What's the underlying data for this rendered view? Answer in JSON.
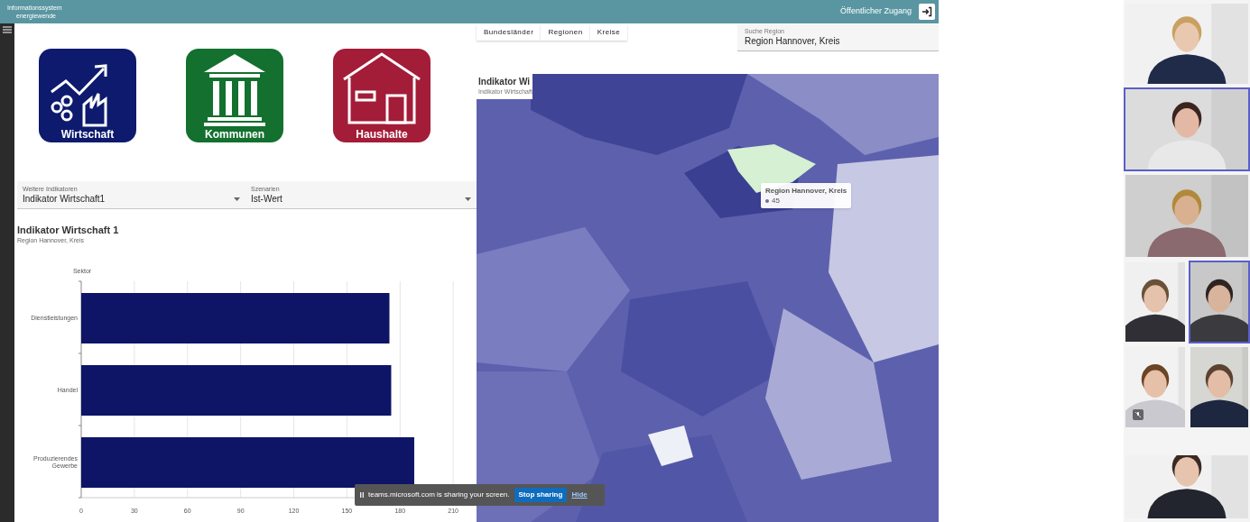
{
  "header": {
    "title_lines": [
      "Informationssystem",
      "energiewende"
    ],
    "access_label": "Öffentlicher Zugang"
  },
  "categories": [
    {
      "kind": "economy",
      "label": "Wirtschaft",
      "color": "#0d1a6e"
    },
    {
      "kind": "municipal",
      "label": "Kommunen",
      "color": "#13702f"
    },
    {
      "kind": "household",
      "label": "Haushalte",
      "color": "#a31c38"
    }
  ],
  "filters": [
    {
      "label": "Weitere Indikatoren",
      "value": "Indikator Wirtschaft1"
    },
    {
      "label": "Szenarien",
      "value": "Ist-Wert"
    }
  ],
  "chart": {
    "title": "Indikator Wirtschaft 1",
    "subtitle": "Region Hannover, Kreis",
    "chart_data": {
      "type": "bar",
      "orientation": "horizontal",
      "ylabel": "Sektor",
      "categories": [
        "Dienstleistungen",
        "Handel",
        "Produzierendes Gewerbe"
      ],
      "series": [
        {
          "color": "#0e1466",
          "values": [
            174,
            175,
            188
          ]
        }
      ],
      "grid": true,
      "xlim": [
        0,
        214
      ],
      "xticks": [
        0,
        30,
        60,
        90,
        120,
        150,
        180,
        210
      ]
    }
  },
  "level_tabs": [
    {
      "label": "Bundesländer",
      "selected": false
    },
    {
      "label": "Regionen",
      "selected": false
    },
    {
      "label": "Kreise",
      "selected": false
    }
  ],
  "search": {
    "label": "Suche Region",
    "value": "Region Hannover, Kreis"
  },
  "map": {
    "kind": "picture",
    "title": "Indikator Wi",
    "subtitle": "Indikator Wirtschaft",
    "tooltip": {
      "title": "Region Hannover, Kreis",
      "value": "45"
    }
  },
  "share_bar": {
    "message": "teams.microsoft.com is sharing your screen.",
    "stop_label": "Stop sharing",
    "hide_label": "Hide"
  },
  "participants": [
    {
      "kind": "picture",
      "highlighted": false,
      "muted": false
    },
    {
      "kind": "picture",
      "highlighted": true,
      "muted": false
    },
    {
      "kind": "picture",
      "highlighted": false,
      "muted": false
    },
    {
      "kind": "picture",
      "highlighted": false,
      "muted": false
    },
    {
      "kind": "picture",
      "highlighted": true,
      "muted": false
    },
    {
      "kind": "picture",
      "highlighted": false,
      "muted": true
    },
    {
      "kind": "picture",
      "highlighted": false,
      "muted": false
    },
    {
      "kind": "picture",
      "highlighted": false,
      "muted": false
    }
  ]
}
